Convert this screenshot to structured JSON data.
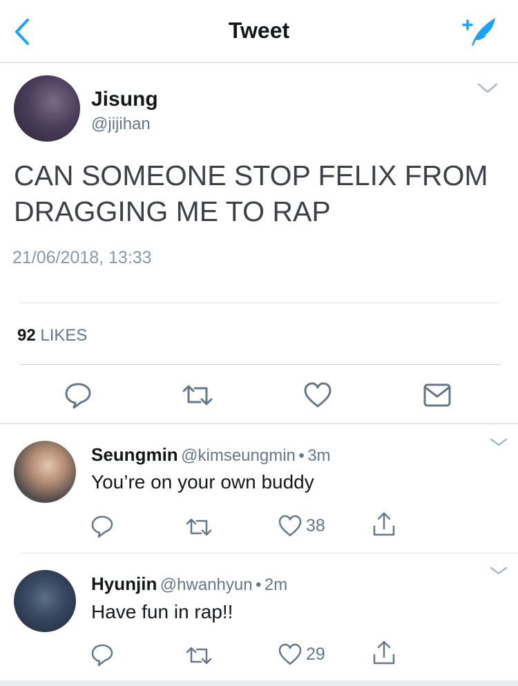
{
  "header": {
    "title": "Tweet"
  },
  "tweet": {
    "name": "Jisung",
    "handle": "@jijihan",
    "text": "CAN SOMEONE STOP FELIX FROM DRAGGING ME TO RAP",
    "timestamp": "21/06/2018, 13:33",
    "likes_count": "92",
    "likes_label": "LIKES"
  },
  "replies": [
    {
      "name": "Seungmin",
      "handle": "@kimseungmin",
      "separator": "•",
      "time": "3m",
      "text": "You’re on your own buddy",
      "likes": "38"
    },
    {
      "name": "Hyunjin",
      "handle": "@hwanhyun",
      "separator": "•",
      "time": "2m",
      "text": "Have fun in rap!!",
      "likes": "29"
    }
  ],
  "colors": {
    "accent": "#1da1f2",
    "icon_gray": "#657786",
    "text_gray": "#8899a6"
  },
  "icons": [
    "back-chevron-icon",
    "compose-feather-icon",
    "chevron-down-icon",
    "reply-icon",
    "retweet-icon",
    "like-heart-icon",
    "direct-message-icon",
    "share-icon"
  ]
}
